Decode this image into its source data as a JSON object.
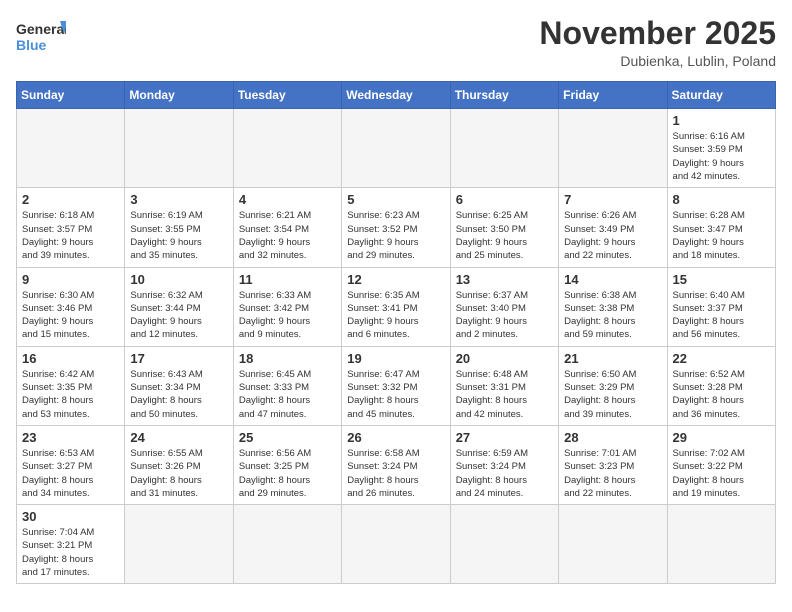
{
  "header": {
    "logo_general": "General",
    "logo_blue": "Blue",
    "month_title": "November 2025",
    "location": "Dubienka, Lublin, Poland"
  },
  "weekdays": [
    "Sunday",
    "Monday",
    "Tuesday",
    "Wednesday",
    "Thursday",
    "Friday",
    "Saturday"
  ],
  "weeks": [
    [
      {
        "day": "",
        "info": ""
      },
      {
        "day": "",
        "info": ""
      },
      {
        "day": "",
        "info": ""
      },
      {
        "day": "",
        "info": ""
      },
      {
        "day": "",
        "info": ""
      },
      {
        "day": "",
        "info": ""
      },
      {
        "day": "1",
        "info": "Sunrise: 6:16 AM\nSunset: 3:59 PM\nDaylight: 9 hours\nand 42 minutes."
      }
    ],
    [
      {
        "day": "2",
        "info": "Sunrise: 6:18 AM\nSunset: 3:57 PM\nDaylight: 9 hours\nand 39 minutes."
      },
      {
        "day": "3",
        "info": "Sunrise: 6:19 AM\nSunset: 3:55 PM\nDaylight: 9 hours\nand 35 minutes."
      },
      {
        "day": "4",
        "info": "Sunrise: 6:21 AM\nSunset: 3:54 PM\nDaylight: 9 hours\nand 32 minutes."
      },
      {
        "day": "5",
        "info": "Sunrise: 6:23 AM\nSunset: 3:52 PM\nDaylight: 9 hours\nand 29 minutes."
      },
      {
        "day": "6",
        "info": "Sunrise: 6:25 AM\nSunset: 3:50 PM\nDaylight: 9 hours\nand 25 minutes."
      },
      {
        "day": "7",
        "info": "Sunrise: 6:26 AM\nSunset: 3:49 PM\nDaylight: 9 hours\nand 22 minutes."
      },
      {
        "day": "8",
        "info": "Sunrise: 6:28 AM\nSunset: 3:47 PM\nDaylight: 9 hours\nand 18 minutes."
      }
    ],
    [
      {
        "day": "9",
        "info": "Sunrise: 6:30 AM\nSunset: 3:46 PM\nDaylight: 9 hours\nand 15 minutes."
      },
      {
        "day": "10",
        "info": "Sunrise: 6:32 AM\nSunset: 3:44 PM\nDaylight: 9 hours\nand 12 minutes."
      },
      {
        "day": "11",
        "info": "Sunrise: 6:33 AM\nSunset: 3:42 PM\nDaylight: 9 hours\nand 9 minutes."
      },
      {
        "day": "12",
        "info": "Sunrise: 6:35 AM\nSunset: 3:41 PM\nDaylight: 9 hours\nand 6 minutes."
      },
      {
        "day": "13",
        "info": "Sunrise: 6:37 AM\nSunset: 3:40 PM\nDaylight: 9 hours\nand 2 minutes."
      },
      {
        "day": "14",
        "info": "Sunrise: 6:38 AM\nSunset: 3:38 PM\nDaylight: 8 hours\nand 59 minutes."
      },
      {
        "day": "15",
        "info": "Sunrise: 6:40 AM\nSunset: 3:37 PM\nDaylight: 8 hours\nand 56 minutes."
      }
    ],
    [
      {
        "day": "16",
        "info": "Sunrise: 6:42 AM\nSunset: 3:35 PM\nDaylight: 8 hours\nand 53 minutes."
      },
      {
        "day": "17",
        "info": "Sunrise: 6:43 AM\nSunset: 3:34 PM\nDaylight: 8 hours\nand 50 minutes."
      },
      {
        "day": "18",
        "info": "Sunrise: 6:45 AM\nSunset: 3:33 PM\nDaylight: 8 hours\nand 47 minutes."
      },
      {
        "day": "19",
        "info": "Sunrise: 6:47 AM\nSunset: 3:32 PM\nDaylight: 8 hours\nand 45 minutes."
      },
      {
        "day": "20",
        "info": "Sunrise: 6:48 AM\nSunset: 3:31 PM\nDaylight: 8 hours\nand 42 minutes."
      },
      {
        "day": "21",
        "info": "Sunrise: 6:50 AM\nSunset: 3:29 PM\nDaylight: 8 hours\nand 39 minutes."
      },
      {
        "day": "22",
        "info": "Sunrise: 6:52 AM\nSunset: 3:28 PM\nDaylight: 8 hours\nand 36 minutes."
      }
    ],
    [
      {
        "day": "23",
        "info": "Sunrise: 6:53 AM\nSunset: 3:27 PM\nDaylight: 8 hours\nand 34 minutes."
      },
      {
        "day": "24",
        "info": "Sunrise: 6:55 AM\nSunset: 3:26 PM\nDaylight: 8 hours\nand 31 minutes."
      },
      {
        "day": "25",
        "info": "Sunrise: 6:56 AM\nSunset: 3:25 PM\nDaylight: 8 hours\nand 29 minutes."
      },
      {
        "day": "26",
        "info": "Sunrise: 6:58 AM\nSunset: 3:24 PM\nDaylight: 8 hours\nand 26 minutes."
      },
      {
        "day": "27",
        "info": "Sunrise: 6:59 AM\nSunset: 3:24 PM\nDaylight: 8 hours\nand 24 minutes."
      },
      {
        "day": "28",
        "info": "Sunrise: 7:01 AM\nSunset: 3:23 PM\nDaylight: 8 hours\nand 22 minutes."
      },
      {
        "day": "29",
        "info": "Sunrise: 7:02 AM\nSunset: 3:22 PM\nDaylight: 8 hours\nand 19 minutes."
      }
    ],
    [
      {
        "day": "30",
        "info": "Sunrise: 7:04 AM\nSunset: 3:21 PM\nDaylight: 8 hours\nand 17 minutes."
      },
      {
        "day": "",
        "info": ""
      },
      {
        "day": "",
        "info": ""
      },
      {
        "day": "",
        "info": ""
      },
      {
        "day": "",
        "info": ""
      },
      {
        "day": "",
        "info": ""
      },
      {
        "day": "",
        "info": ""
      }
    ]
  ]
}
